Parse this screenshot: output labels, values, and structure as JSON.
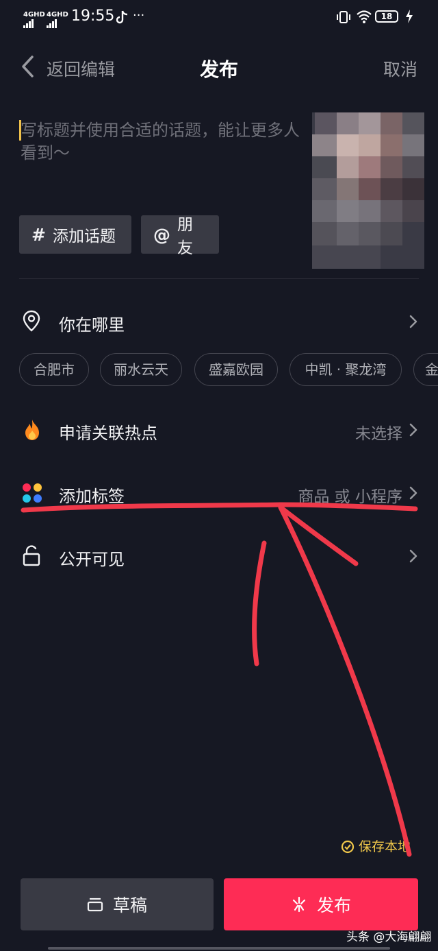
{
  "status_bar": {
    "network1": "4GHD",
    "network2": "4GHD",
    "time": "19:55",
    "more": "···",
    "battery": "18",
    "icons": [
      "tiktok-icon",
      "vibrate-icon",
      "wifi-icon",
      "battery-icon",
      "charging-icon"
    ]
  },
  "header": {
    "back_label": "返回编辑",
    "title": "发布",
    "cancel_label": "取消"
  },
  "caption": {
    "placeholder": "写标题并使用合适的话题，能让更多人看到～"
  },
  "chips": {
    "topic_symbol": "#",
    "topic_label": "添加话题",
    "mention_symbol": "@",
    "mention_label": "朋友"
  },
  "location": {
    "label": "你在哪里",
    "suggestions": [
      "合肥市",
      "丽水云天",
      "盛嘉欧园",
      "中凯 · 聚龙湾",
      "金"
    ]
  },
  "hotspot": {
    "label": "申请关联热点",
    "value": "未选择"
  },
  "tags": {
    "label": "添加标签",
    "value": "商品 或 小程序"
  },
  "visibility": {
    "label": "公开可见"
  },
  "save_local": {
    "label": "保存本地"
  },
  "buttons": {
    "draft_label": "草稿",
    "publish_label": "发布"
  },
  "watermark": "头条 @大海翩翩",
  "colors": {
    "background": "#161823",
    "primary": "#fe2c55",
    "chip_bg": "#393a44",
    "accent_yellow": "#f1c84b",
    "annotation_red": "#f0394a"
  }
}
